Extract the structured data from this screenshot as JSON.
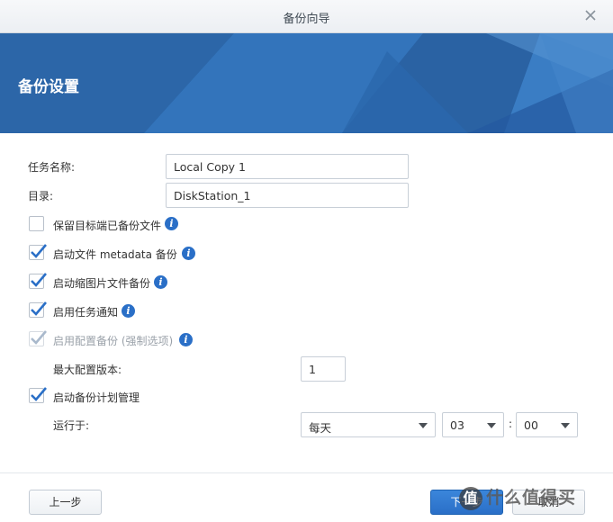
{
  "window": {
    "title": "备份向导"
  },
  "banner": {
    "title": "备份设置"
  },
  "form": {
    "task_name_label": "任务名称:",
    "task_name_value": "Local Copy 1",
    "directory_label": "目录:",
    "directory_value": "DiskStation_1",
    "options": [
      {
        "label": "保留目标端已备份文件",
        "checked": false,
        "disabled": false
      },
      {
        "label": "启动文件 metadata 备份",
        "checked": true,
        "disabled": false
      },
      {
        "label": "启动缩图片文件备份",
        "checked": true,
        "disabled": false
      },
      {
        "label": "启用任务通知",
        "checked": true,
        "disabled": false
      },
      {
        "label": "启用配置备份 (强制选项)",
        "checked": true,
        "disabled": true
      },
      {
        "label": "启动备份计划管理",
        "checked": true,
        "disabled": false
      }
    ],
    "max_versions_label": "最大配置版本:",
    "max_versions_value": "1",
    "run_at_label": "运行于:",
    "frequency_value": "每天",
    "hour_value": "03",
    "time_separator": ":",
    "minute_value": "00"
  },
  "footer": {
    "prev_label": "上一步",
    "next_label": "下一步",
    "cancel_label": "取消"
  },
  "watermark": {
    "text": "什么值得买",
    "badge": "值"
  },
  "colors": {
    "accent": "#2a6fc7",
    "banner": "#2f6db0"
  }
}
